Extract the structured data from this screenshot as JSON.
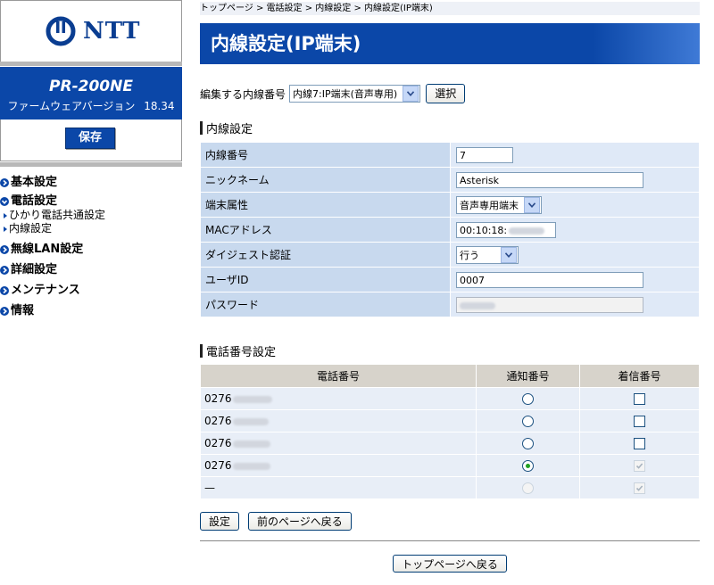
{
  "sidebar": {
    "logo_text": "NTT",
    "model": "PR-200NE",
    "firmware_label": "ファームウェアバージョン",
    "firmware_version": "18.34",
    "save_label": "保存",
    "nav": [
      {
        "label": "基本設定"
      },
      {
        "label": "電話設定",
        "children": [
          {
            "label": "ひかり電話共通設定"
          },
          {
            "label": "内線設定"
          }
        ]
      },
      {
        "label": "無線LAN設定"
      },
      {
        "label": "詳細設定"
      },
      {
        "label": "メンテナンス"
      },
      {
        "label": "情報"
      }
    ]
  },
  "breadcrumb": "トップページ > 電話設定 > 内線設定 > 内線設定(IP端末)",
  "page_title": "内線設定(IP端末)",
  "edit_select": {
    "label": "編集する内線番号",
    "value": "内線7:IP端末(音声専用)",
    "button": "選択"
  },
  "extension_section": {
    "heading": "内線設定",
    "rows": [
      {
        "label": "内線番号",
        "value": "7"
      },
      {
        "label": "ニックネーム",
        "value": "Asterisk"
      },
      {
        "label": "端末属性",
        "value": "音声専用端末"
      },
      {
        "label": "MACアドレス",
        "value": "00:10:18:"
      },
      {
        "label": "ダイジェスト認証",
        "value": "行う"
      },
      {
        "label": "ユーザID",
        "value": "0007"
      },
      {
        "label": "パスワード",
        "value": ""
      }
    ]
  },
  "phone_section": {
    "heading": "電話番号設定",
    "headers": [
      "電話番号",
      "通知番号",
      "着信番号"
    ],
    "rows": [
      {
        "number": "0276",
        "notify": false,
        "notify_disabled": false,
        "incoming": false,
        "incoming_disabled": false
      },
      {
        "number": "0276",
        "notify": false,
        "notify_disabled": false,
        "incoming": false,
        "incoming_disabled": false
      },
      {
        "number": "0276",
        "notify": false,
        "notify_disabled": false,
        "incoming": false,
        "incoming_disabled": false
      },
      {
        "number": "0276",
        "notify": true,
        "notify_disabled": false,
        "incoming": true,
        "incoming_disabled": true
      },
      {
        "number": "—",
        "notify": false,
        "notify_disabled": true,
        "incoming": true,
        "incoming_disabled": true
      }
    ]
  },
  "buttons": {
    "set": "設定",
    "back": "前のページへ戻る",
    "top": "トップページへ戻る"
  },
  "colors": {
    "brand_blue": "#0b47a8",
    "label_cell": "#c8d9ee",
    "value_cell": "#dfe9f7"
  }
}
